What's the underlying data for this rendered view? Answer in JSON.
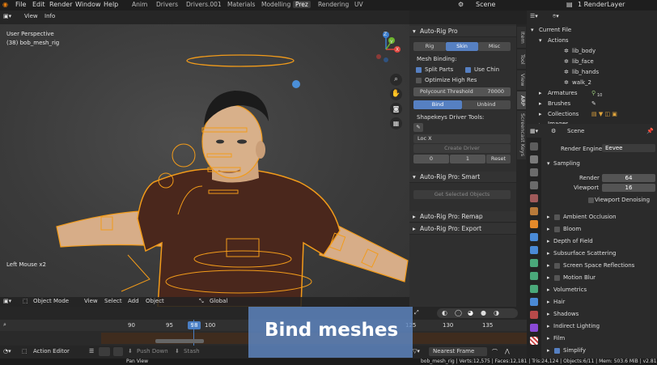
{
  "menubar": {
    "items": [
      "File",
      "Edit",
      "Render",
      "Window",
      "Help"
    ],
    "workspace_tabs": [
      "Anim",
      "Drivers",
      "Drivers.001",
      "Materials",
      "Modelling",
      "Prez",
      "Rendering",
      "UV"
    ],
    "active_tab": "Prez",
    "scene_label": "Scene",
    "render_layer_label": "1 RenderLayer"
  },
  "viewport_header": {
    "view": "View",
    "info": "Info"
  },
  "viewport": {
    "perspective": "User Perspective",
    "object_info": "(38) bob_mesh_rig",
    "last_op": "Left Mouse x2",
    "gizmo_axes": {
      "x": "X",
      "y": "Y",
      "z": "Z"
    }
  },
  "npanel": {
    "title": "Auto-Rig Pro",
    "tabs": [
      "Rig",
      "Skin",
      "Misc"
    ],
    "active_tab": "Skin",
    "mesh_binding_label": "Mesh Binding:",
    "split_parts": "Split Parts",
    "use_chin": "Use Chin",
    "optimize_high_res": "Optimize High Res",
    "polycount_threshold_label": "Polycount Threshold",
    "polycount_threshold_value": "70000",
    "bind_label": "Bind",
    "unbind_label": "Unbind",
    "shapekeys_label": "Shapekeys Driver Tools:",
    "loc_x": "Loc X",
    "create_driver": "Create Driver",
    "driver_values": [
      "0",
      "1"
    ],
    "reset_label": "Reset",
    "smart_title": "Auto-Rig Pro: Smart",
    "get_selected": "Get Selected Objects",
    "remap_title": "Auto-Rig Pro: Remap",
    "export_title": "Auto-Rig Pro: Export"
  },
  "side_tabs": [
    "Item",
    "Tool",
    "View",
    "ARP",
    "Screencast Keys"
  ],
  "outliner": {
    "current_file": "Current File",
    "actions_label": "Actions",
    "actions": [
      "lib_body",
      "lib_face",
      "lib_hands",
      "walk_2"
    ],
    "armatures": "Armatures",
    "armatures_count": "10",
    "brushes": "Brushes",
    "collections": "Collections",
    "images": "Images"
  },
  "properties": {
    "scene": "Scene",
    "render_engine_label": "Render Engine",
    "render_engine_value": "Eevee",
    "sampling_label": "Sampling",
    "render_label": "Render",
    "render_value": "64",
    "viewport_label": "Viewport",
    "viewport_value": "16",
    "viewport_denoising": "Viewport Denoising",
    "sections": [
      "Ambient Occlusion",
      "Bloom",
      "Depth of Field",
      "Subsurface Scattering",
      "Screen Space Reflections",
      "Motion Blur",
      "Volumetrics",
      "Hair",
      "Shadows",
      "Indirect Lighting",
      "Film",
      "Simplify"
    ],
    "checkbox_sections": [
      "Ambient Occlusion",
      "Bloom",
      "Screen Space Reflections",
      "Motion Blur",
      "Simplify"
    ]
  },
  "viewport_toolbar": {
    "mode": "Object Mode",
    "view": "View",
    "select": "Select",
    "add": "Add",
    "object": "Object",
    "transform": "Global"
  },
  "timeline": {
    "ticks": [
      "90",
      "95",
      "98",
      "100",
      "125",
      "130",
      "135"
    ],
    "current_frame": "98"
  },
  "action_editor": {
    "editor": "Action Editor",
    "push_down": "Push Down",
    "stash": "Stash",
    "snap": "Nearest Frame"
  },
  "status": {
    "pan_view": "Pan View",
    "stats": "bob_mesh_rig | Verts:12,575 | Faces:12,181 | Tris:24,124 | Objects:6/11 | Mem: 503.6 MiB | v2.81"
  },
  "banner": {
    "text": "Bind meshes"
  },
  "colors": {
    "accent": "#5680c2",
    "rig_orange": "#f29b1a",
    "banner": "#5f87c3",
    "skin": "#d8b08a",
    "shirt": "#4a271c"
  }
}
